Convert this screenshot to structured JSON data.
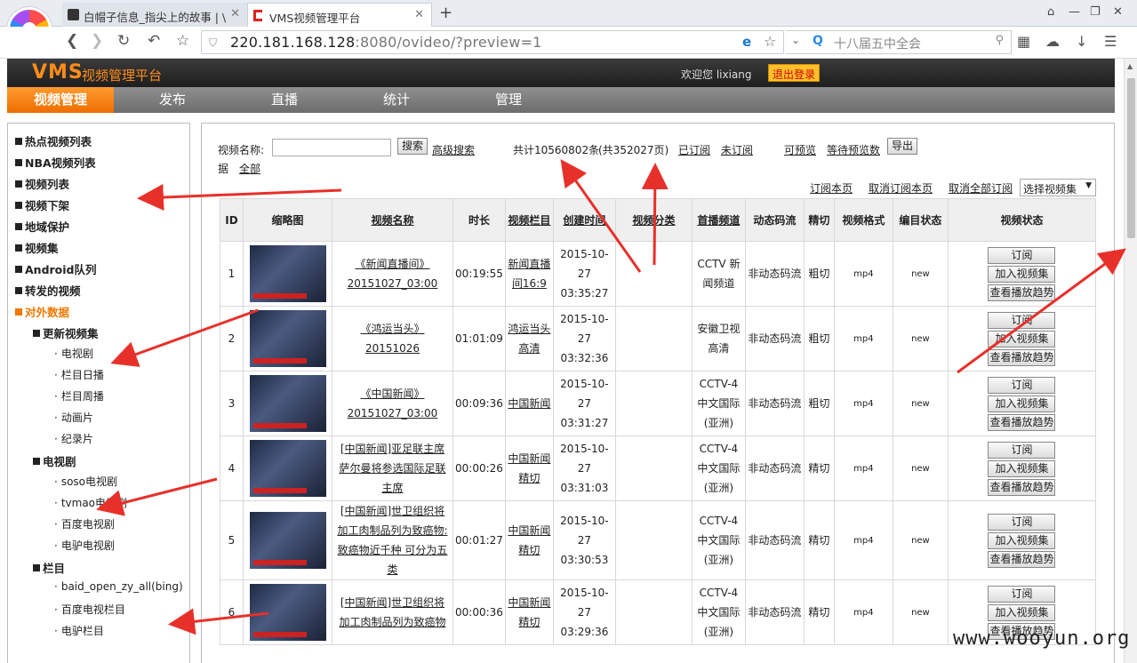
{
  "browser": {
    "tabs": [
      {
        "title": "白帽子信息_指尖上的故事 | \\",
        "active": false
      },
      {
        "title": "VMS视频管理平台",
        "active": true
      }
    ],
    "url_host": "220.181.168.128",
    "url_rest": ":8080/ovideo/?preview=1",
    "search_text": "十八届五中全会"
  },
  "header": {
    "logo": "VMS",
    "subtitle": "视频管理平台",
    "welcome": "欢迎您 lixiang",
    "logout": "退出登录"
  },
  "menu": [
    "视频管理",
    "发布",
    "直播",
    "统计",
    "管理"
  ],
  "sidebar": {
    "items": [
      {
        "label": "热点视频列表",
        "level": 0,
        "open": false
      },
      {
        "label": "NBA视频列表",
        "level": 0,
        "open": false
      },
      {
        "label": "视频列表",
        "level": 0,
        "open": false
      },
      {
        "label": "视频下架",
        "level": 0,
        "open": false
      },
      {
        "label": "地域保护",
        "level": 0,
        "open": false
      },
      {
        "label": "视频集",
        "level": 0,
        "open": false
      },
      {
        "label": "Android队列",
        "level": 0,
        "open": false
      },
      {
        "label": "转发的视频",
        "level": 0,
        "open": false
      },
      {
        "label": "对外数据",
        "level": 0,
        "open": true
      },
      {
        "label": "更新视频集",
        "level": 1
      },
      {
        "label": "电视剧",
        "level": 2
      },
      {
        "label": "栏目日播",
        "level": 2
      },
      {
        "label": "栏目周播",
        "level": 2
      },
      {
        "label": "动画片",
        "level": 2
      },
      {
        "label": "纪录片",
        "level": 2
      },
      {
        "label": "电视剧",
        "level": 1
      },
      {
        "label": "soso电视剧",
        "level": 2
      },
      {
        "label": "tvmao电视剧",
        "level": 2
      },
      {
        "label": "百度电视剧",
        "level": 2
      },
      {
        "label": "电驴电视剧",
        "level": 2
      },
      {
        "label": "栏目",
        "level": 1
      },
      {
        "label": "baid_open_zy_all(bing)",
        "level": 2
      },
      {
        "label": "百度电视栏目",
        "level": 2
      },
      {
        "label": "电驴栏目",
        "level": 2
      }
    ]
  },
  "toolbar": {
    "name_label": "视频名称:",
    "search_btn": "搜索",
    "adv_search": "高级搜索",
    "total": "共计10560802条",
    "pages": "(共352027页)",
    "subscribed": "已订阅",
    "unsubscribed": "未订阅",
    "previewable": "可预览",
    "waiting_preview": "等待预览数",
    "export": "导出",
    "data": "据",
    "all": "全部",
    "sub_page": "订阅本页",
    "unsub_page": "取消订阅本页",
    "unsub_all": "取消全部订阅",
    "select_set": "选择视频集"
  },
  "table": {
    "headers": [
      "ID",
      "缩略图",
      "视频名称",
      "时长",
      "视频栏目",
      "创建时间",
      "视频分类",
      "首播频道",
      "动态码流",
      "精切",
      "视频格式",
      "编目状态",
      "视频状态"
    ],
    "actions": [
      "订阅",
      "加入视频集",
      "查看播放趋势"
    ],
    "rows": [
      {
        "id": "1",
        "name": "《新闻直播间》 20151027_03:00",
        "duration": "00:19:55",
        "column": "新闻直播间16:9",
        "created": "2015-10-27 03:35:27",
        "category": "",
        "channel": "CCTV 新闻频道",
        "bitrate": "非动态码流",
        "cut": "粗切",
        "format": "mp4",
        "catalog": "new"
      },
      {
        "id": "2",
        "name": "《鸿运当头》 20151026",
        "duration": "01:01:09",
        "column": "鸿运当头高清",
        "created": "2015-10-27 03:32:36",
        "category": "",
        "channel": "安徽卫视高清",
        "bitrate": "非动态码流",
        "cut": "粗切",
        "format": "mp4",
        "catalog": "new"
      },
      {
        "id": "3",
        "name": "《中国新闻》 20151027_03:00",
        "duration": "00:09:36",
        "column": "中国新闻",
        "created": "2015-10-27 03:31:27",
        "category": "",
        "channel": "CCTV-4 中文国际(亚洲)",
        "bitrate": "非动态码流",
        "cut": "粗切",
        "format": "mp4",
        "catalog": "new"
      },
      {
        "id": "4",
        "name": "[中国新闻]亚足联主席萨尔曼将参选国际足联主席",
        "duration": "00:00:26",
        "column": "中国新闻精切",
        "created": "2015-10-27 03:31:03",
        "category": "",
        "channel": "CCTV-4 中文国际(亚洲)",
        "bitrate": "非动态码流",
        "cut": "精切",
        "format": "mp4",
        "catalog": "new"
      },
      {
        "id": "5",
        "name": "[中国新闻]世卫组织将加工肉制品列为致癌物:致癌物近千种 可分为五类",
        "duration": "00:01:27",
        "column": "中国新闻精切",
        "created": "2015-10-27 03:30:53",
        "category": "",
        "channel": "CCTV-4 中文国际(亚洲)",
        "bitrate": "非动态码流",
        "cut": "精切",
        "format": "mp4",
        "catalog": "new"
      },
      {
        "id": "6",
        "name": "[中国新闻]世卫组织将加工肉制品列为致癌物",
        "duration": "00:00:36",
        "column": "中国新闻精切",
        "created": "2015-10-27 03:29:36",
        "category": "",
        "channel": "CCTV-4 中文国际(亚洲)",
        "bitrate": "非动态码流",
        "cut": "精切",
        "format": "mp4",
        "catalog": "new"
      }
    ]
  },
  "watermark": "www.wooyun.org",
  "colors": {
    "accent": "#ff8c1a",
    "arrow": "#e8302a",
    "header_bg": "#2a2a2a"
  }
}
